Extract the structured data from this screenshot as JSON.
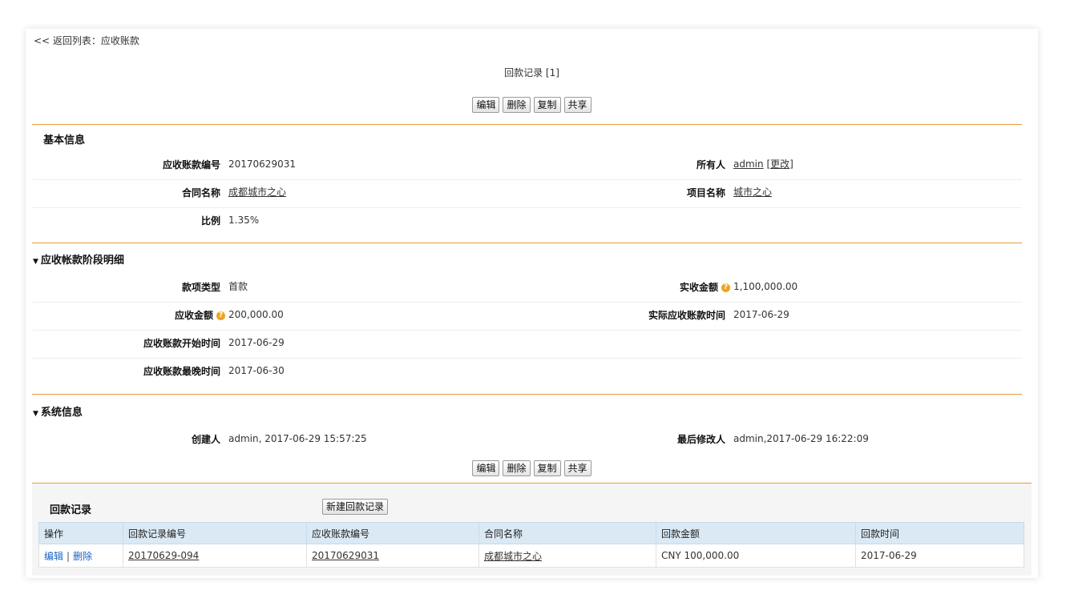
{
  "back_link": "<< 返回列表：应收账款",
  "page_title": "回款记录 [1]",
  "toolbar": {
    "edit": "编辑",
    "delete": "删除",
    "copy": "复制",
    "share": "共享"
  },
  "basic": {
    "title": "基本信息",
    "receivable_no_label": "应收账款编号",
    "receivable_no": "20170629031",
    "owner_label": "所有人",
    "owner": "admin",
    "owner_change": "[更改]",
    "contract_label": "合同名称",
    "contract": "成都城市之心",
    "project_label": "项目名称",
    "project": "城市之心",
    "ratio_label": "比例",
    "ratio": "1.35%"
  },
  "stage": {
    "title": "应收帐款阶段明细",
    "type_label": "款项类型",
    "type": "首款",
    "actual_amount_label": "实收金额",
    "actual_amount": "1,100,000.00",
    "due_amount_label": "应收金额",
    "due_amount": "200,000.00",
    "actual_time_label": "实际应收账款时间",
    "actual_time": "2017-06-29",
    "start_label": "应收账款开始时间",
    "start": "2017-06-29",
    "latest_label": "应收账款最晚时间",
    "latest": "2017-06-30"
  },
  "system": {
    "title": "系统信息",
    "creator_label": "创建人",
    "creator": "admin, 2017-06-29 15:57:25",
    "modifier_label": "最后修改人",
    "modifier": "admin,2017-06-29 16:22:09"
  },
  "related": {
    "title": "回款记录",
    "new_button": "新建回款记录",
    "columns": [
      "操作",
      "回款记录编号",
      "应收账款编号",
      "合同名称",
      "回款金额",
      "回款时间"
    ],
    "rows": [
      {
        "edit": "编辑",
        "delete": "删除",
        "record_no": "20170629-094",
        "receivable_no": "20170629031",
        "contract": "成都城市之心",
        "amount": "CNY 100,000.00",
        "date": "2017-06-29"
      }
    ]
  }
}
